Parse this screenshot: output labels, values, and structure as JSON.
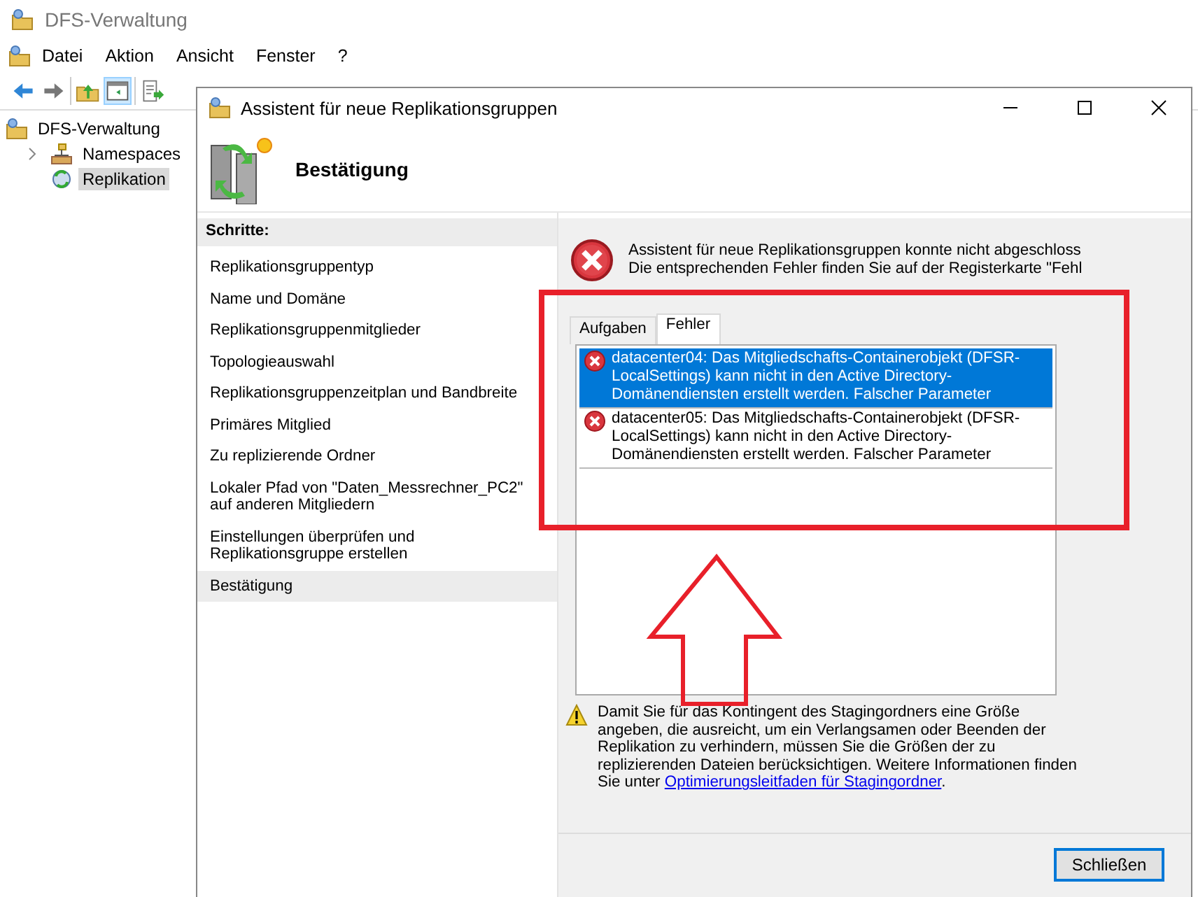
{
  "app": {
    "title": "DFS-Verwaltung",
    "menu": [
      "Datei",
      "Aktion",
      "Ansicht",
      "Fenster",
      "?"
    ],
    "tree": [
      {
        "label": "DFS-Verwaltung",
        "selected": false,
        "children": [
          {
            "label": "Namespaces",
            "expanded": false,
            "selected": false
          },
          {
            "label": "Replikation",
            "selected": true
          }
        ]
      }
    ]
  },
  "dialog": {
    "title": "Assistent für neue Replikationsgruppen",
    "heading": "Bestätigung",
    "steps_title": "Schritte:",
    "steps": [
      {
        "label": "Replikationsgruppentyp",
        "selected": false
      },
      {
        "label": "Name und Domäne",
        "selected": false
      },
      {
        "label": "Replikationsgruppenmitglieder",
        "selected": false
      },
      {
        "label": "Topologieauswahl",
        "selected": false
      },
      {
        "label": "Replikationsgruppenzeitplan und Bandbreite",
        "selected": false
      },
      {
        "label": "Primäres Mitglied",
        "selected": false
      },
      {
        "label": "Zu replizierende Ordner",
        "selected": false
      },
      {
        "label": "Lokaler Pfad von \"Daten_Messrechner_PC2\" auf anderen Mitgliedern",
        "selected": false
      },
      {
        "label": "Einstellungen überprüfen und Replikationsgruppe erstellen",
        "selected": false
      },
      {
        "label": "Bestätigung",
        "selected": true
      }
    ],
    "status_lines": [
      "Assistent für neue Replikationsgruppen konnte nicht abgeschloss",
      "Die entsprechenden Fehler finden Sie auf der Registerkarte \"Fehl"
    ],
    "tabs": [
      {
        "label": "Aufgaben",
        "selected": false
      },
      {
        "label": "Fehler",
        "selected": true
      }
    ],
    "errors": [
      {
        "text": "datacenter04: Das Mitgliedschafts-Containerobjekt (DFSR-LocalSettings) kann nicht in den Active Directory-Domänendiensten erstellt werden. Falscher Parameter",
        "selected": true
      },
      {
        "text": "datacenter05: Das Mitgliedschafts-Containerobjekt (DFSR-LocalSettings) kann nicht in den Active Directory-Domänendiensten erstellt werden. Falscher Parameter",
        "selected": false
      }
    ],
    "warning": {
      "text": "Damit Sie für das Kontingent des Stagingordners eine Größe angeben, die ausreicht, um ein Verlangsamen oder Beenden der Replikation zu verhindern, müssen Sie die Größen der zu replizierenden Dateien berücksichtigen. Weitere Informationen finden Sie unter ",
      "link": "Optimierungsleitfaden für Stagingordner",
      "after": "."
    },
    "button": "Schließen"
  }
}
